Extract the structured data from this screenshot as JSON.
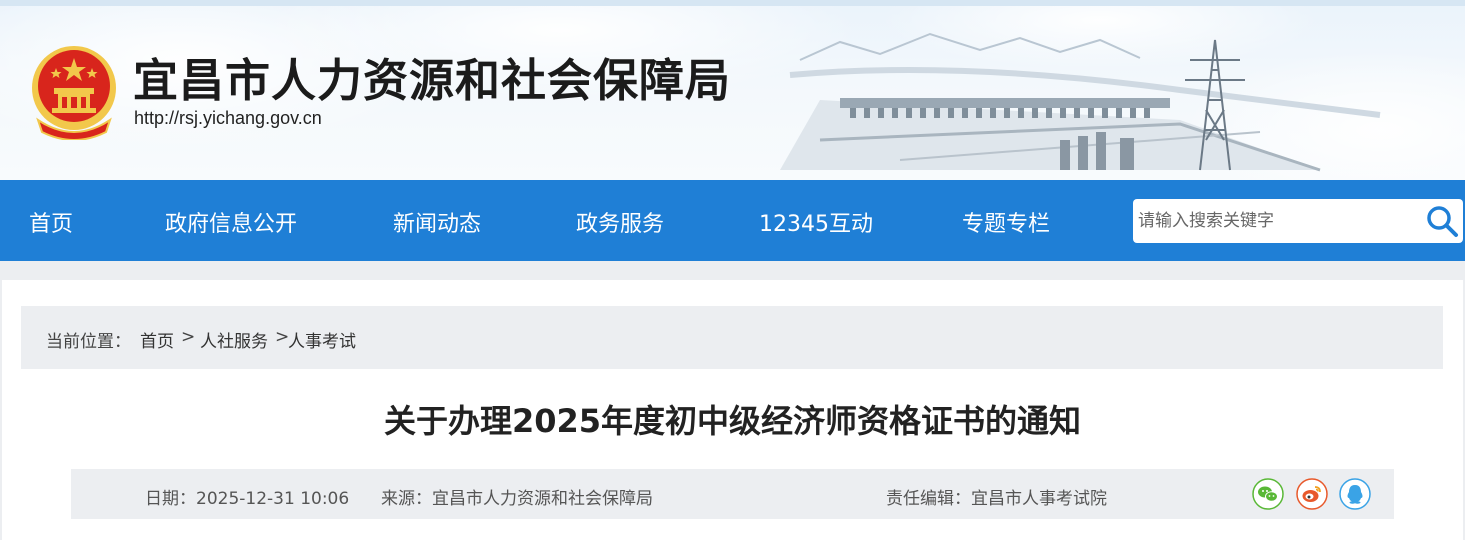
{
  "header": {
    "site_title": "宜昌市人力资源和社会保障局",
    "site_url": "http://rsj.yichang.gov.cn",
    "emblem_icon": "national-emblem-icon"
  },
  "nav": {
    "items": [
      {
        "label": "首页"
      },
      {
        "label": "政府信息公开"
      },
      {
        "label": "新闻动态"
      },
      {
        "label": "政务服务"
      },
      {
        "label": "12345互动"
      },
      {
        "label": "专题专栏"
      }
    ],
    "search": {
      "placeholder": "请输入搜索关键字",
      "icon": "search-icon"
    }
  },
  "breadcrumb": {
    "prefix": "当前位置：",
    "home": "首页",
    "sep1": ">",
    "level1": "人社服务",
    "sep2": ">",
    "level2": "人事考试"
  },
  "article": {
    "title": "关于办理2025年度初中级经济师资格证书的通知",
    "date": "日期：2025-12-31 10:06",
    "source": "来源：宜昌市人力资源和社会保障局",
    "editor": "责任编辑：宜昌市人事考试院",
    "share": [
      {
        "icon": "wechat-icon"
      },
      {
        "icon": "weibo-icon"
      },
      {
        "icon": "qq-icon"
      }
    ]
  },
  "colors": {
    "nav_bg": "#1f7fd6",
    "search_icon": "#1f7fd6",
    "wechat": "#59b836",
    "weibo": "#e8592b",
    "qq": "#3aa3e6",
    "emblem_red": "#d8251c",
    "emblem_gold": "#f2c84b"
  }
}
